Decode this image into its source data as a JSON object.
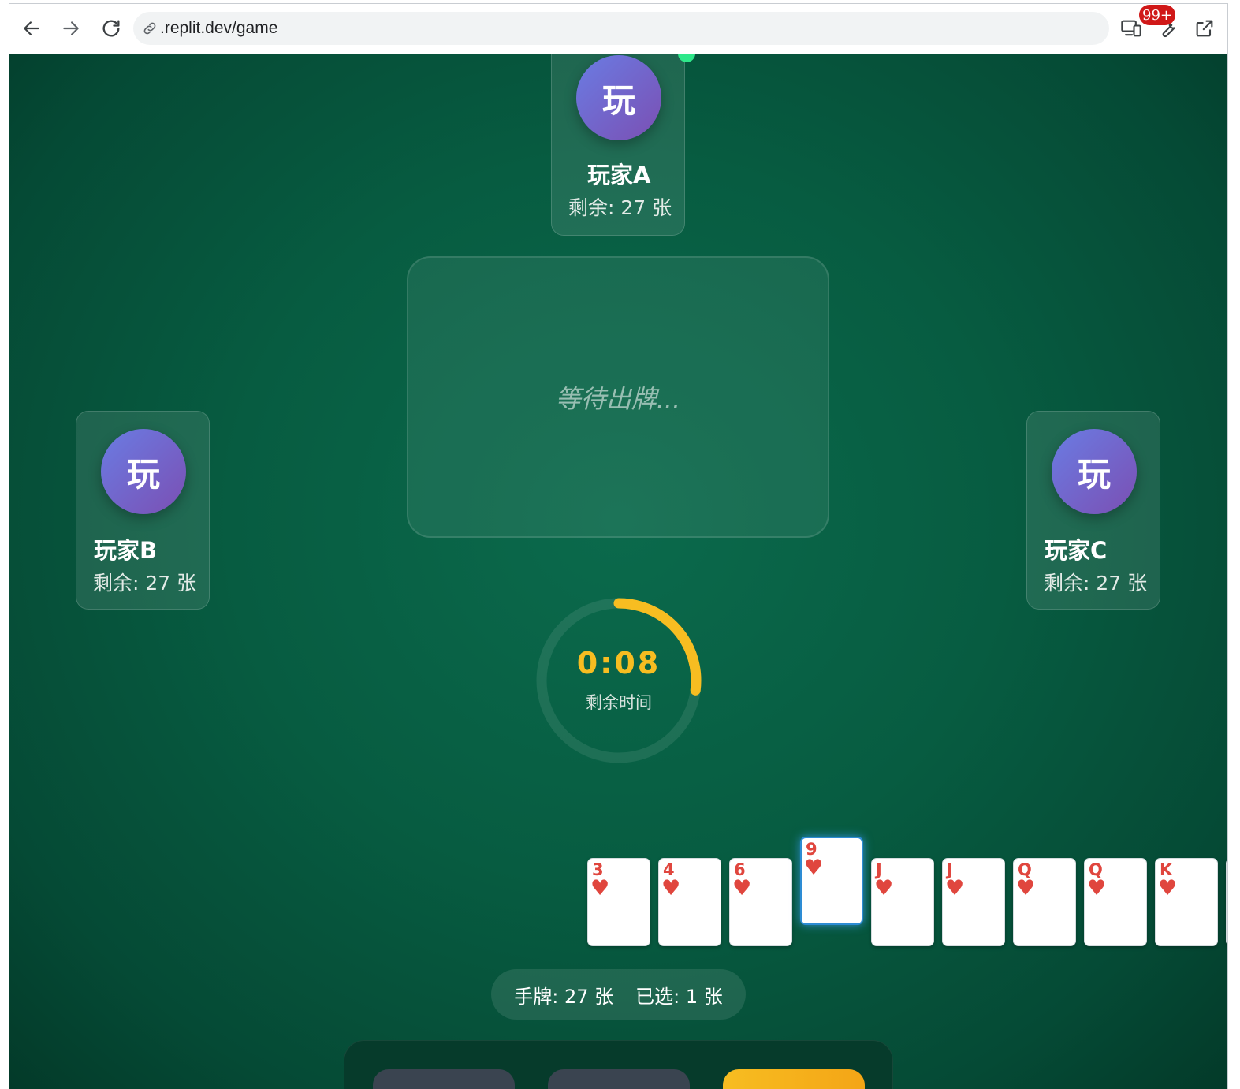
{
  "browser": {
    "url": ".replit.dev/game",
    "badge": "99+"
  },
  "players": {
    "top": {
      "avatar": "玩",
      "name": "玩家A",
      "remaining": "剩余: 27 张"
    },
    "left": {
      "avatar": "玩",
      "name": "玩家B",
      "remaining": "剩余: 27 张"
    },
    "right": {
      "avatar": "玩",
      "name": "玩家C",
      "remaining": "剩余: 27 张"
    }
  },
  "play_area": {
    "waiting_text": "等待出牌..."
  },
  "timer": {
    "time": "0:08",
    "label": "剩余时间",
    "progress_fraction": 0.27,
    "color": "#f7bd21"
  },
  "hand": {
    "cards": [
      {
        "rank": "3",
        "suit": "♥",
        "selected": false
      },
      {
        "rank": "4",
        "suit": "♥",
        "selected": false
      },
      {
        "rank": "6",
        "suit": "♥",
        "selected": false
      },
      {
        "rank": "9",
        "suit": "♥",
        "selected": true
      },
      {
        "rank": "J",
        "suit": "♥",
        "selected": false
      },
      {
        "rank": "J",
        "suit": "♥",
        "selected": false
      },
      {
        "rank": "Q",
        "suit": "♥",
        "selected": false
      },
      {
        "rank": "Q",
        "suit": "♥",
        "selected": false
      },
      {
        "rank": "K",
        "suit": "♥",
        "selected": false
      }
    ],
    "count_text": "手牌: 27 张",
    "selected_text": "已选: 1 张"
  },
  "colors": {
    "table": "#075c41",
    "heart": "#e0463e",
    "accent": "#f7bd21",
    "avatar_gradient": [
      "#6a7ce3",
      "#7b4fb3"
    ]
  }
}
